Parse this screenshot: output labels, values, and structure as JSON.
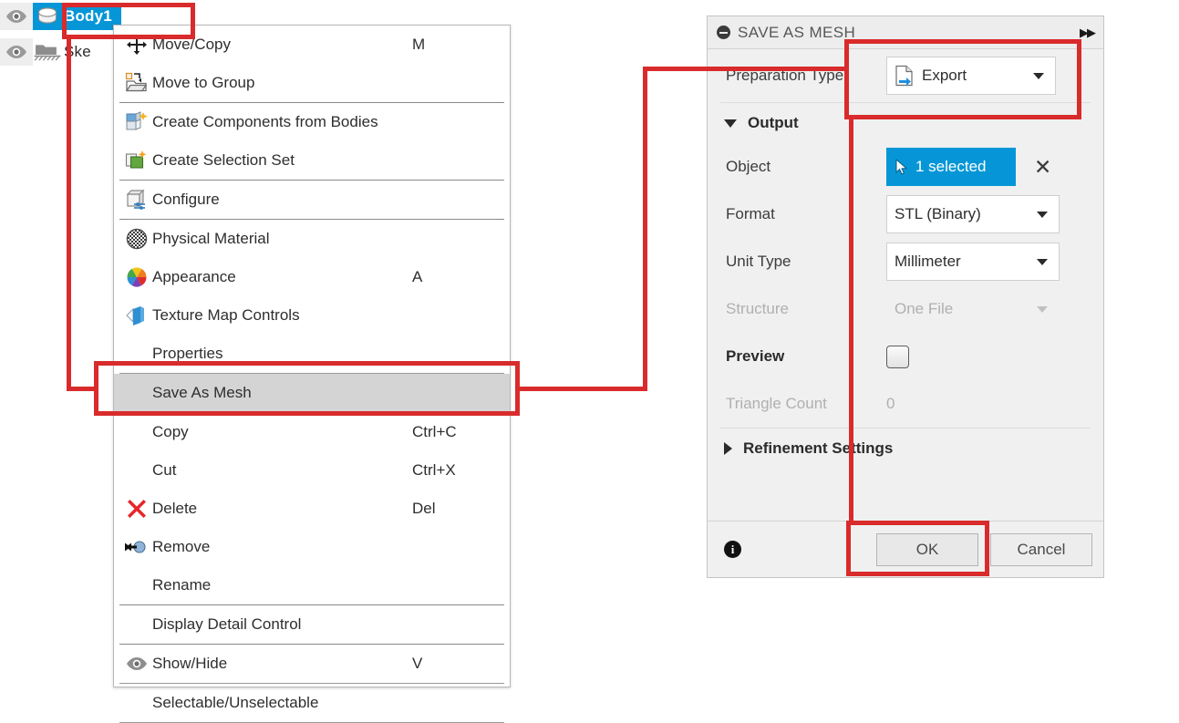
{
  "tree": {
    "items": [
      {
        "label": "Body1",
        "icon": "body-cylinder-icon",
        "selected": true,
        "eye": "eye-icon"
      },
      {
        "label": "Ske",
        "icon": "sketch-folder-icon",
        "selected": false,
        "eye": "eye-icon"
      }
    ]
  },
  "context_menu": {
    "items": [
      {
        "label": "Move/Copy",
        "shortcut": "M",
        "icon": "move-arrows-icon",
        "highlight": false,
        "sep_after": false
      },
      {
        "label": "Move to Group",
        "shortcut": "",
        "icon": "move-to-group-folder-icon",
        "highlight": false,
        "sep_after": true
      },
      {
        "label": "Create Components from Bodies",
        "shortcut": "",
        "icon": "create-components-icon",
        "highlight": false,
        "sep_after": false
      },
      {
        "label": "Create Selection Set",
        "shortcut": "",
        "icon": "create-selection-set-icon",
        "highlight": false,
        "sep_after": true
      },
      {
        "label": "Configure",
        "shortcut": "",
        "icon": "configure-cube-icon",
        "highlight": false,
        "sep_after": true
      },
      {
        "label": "Physical Material",
        "shortcut": "",
        "icon": "physical-material-checker-icon",
        "highlight": false,
        "sep_after": false
      },
      {
        "label": "Appearance",
        "shortcut": "A",
        "icon": "appearance-color-wheel-icon",
        "highlight": false,
        "sep_after": false
      },
      {
        "label": "Texture Map Controls",
        "shortcut": "",
        "icon": "texture-map-icon",
        "highlight": false,
        "sep_after": false
      },
      {
        "label": "Properties",
        "shortcut": "",
        "icon": "",
        "highlight": false,
        "sep_after": true
      },
      {
        "label": "Save As Mesh",
        "shortcut": "",
        "icon": "",
        "highlight": true,
        "sep_after": true
      },
      {
        "label": "Copy",
        "shortcut": "Ctrl+C",
        "icon": "",
        "highlight": false,
        "sep_after": false
      },
      {
        "label": "Cut",
        "shortcut": "Ctrl+X",
        "icon": "",
        "highlight": false,
        "sep_after": false
      },
      {
        "label": "Delete",
        "shortcut": "Del",
        "icon": "delete-x-icon",
        "highlight": false,
        "sep_after": false
      },
      {
        "label": "Remove",
        "shortcut": "",
        "icon": "remove-arrow-icon",
        "highlight": false,
        "sep_after": false
      },
      {
        "label": "Rename",
        "shortcut": "",
        "icon": "",
        "highlight": false,
        "sep_after": true
      },
      {
        "label": "Display Detail Control",
        "shortcut": "",
        "icon": "",
        "highlight": false,
        "sep_after": true
      },
      {
        "label": "Show/Hide",
        "shortcut": "V",
        "icon": "eye-icon",
        "highlight": false,
        "sep_after": true
      },
      {
        "label": "Selectable/Unselectable",
        "shortcut": "",
        "icon": "",
        "highlight": false,
        "sep_after": true
      }
    ]
  },
  "panel": {
    "title": "SAVE AS MESH",
    "collapse_icon": "collapse-minus-icon",
    "expand_icon": "double-chevron-right-icon",
    "preparation_type": {
      "label": "Preparation Type",
      "value": "Export",
      "icon": "export-file-icon"
    },
    "output_section": {
      "label": "Output",
      "expanded": true,
      "object": {
        "label": "Object",
        "value": "1 selected",
        "cursor_icon": "select-cursor-icon",
        "clear_icon": "clear-x-icon"
      },
      "format": {
        "label": "Format",
        "value": "STL (Binary)"
      },
      "unit_type": {
        "label": "Unit Type",
        "value": "Millimeter"
      },
      "structure": {
        "label": "Structure",
        "value": "One File",
        "disabled": true
      },
      "preview": {
        "label": "Preview",
        "checked": false
      },
      "triangle_count": {
        "label": "Triangle Count",
        "value": "0",
        "disabled": true
      }
    },
    "refinement_section": {
      "label": "Refinement Settings",
      "expanded": false
    },
    "footer": {
      "info_icon": "info-icon",
      "ok_label": "OK",
      "cancel_label": "Cancel"
    }
  },
  "annotations": {
    "highlight_color": "#d92b2b",
    "boxes": [
      {
        "name": "body1-tree-node-highlight"
      },
      {
        "name": "save-as-mesh-menu-item-highlight"
      },
      {
        "name": "preparation-type-export-highlight"
      },
      {
        "name": "ok-button-highlight"
      }
    ]
  },
  "colors": {
    "accent_blue": "#0696d7",
    "annotation_red": "#d92b2b",
    "panel_bg": "#f0f0f0",
    "menu_highlight": "#d4d4d4"
  }
}
